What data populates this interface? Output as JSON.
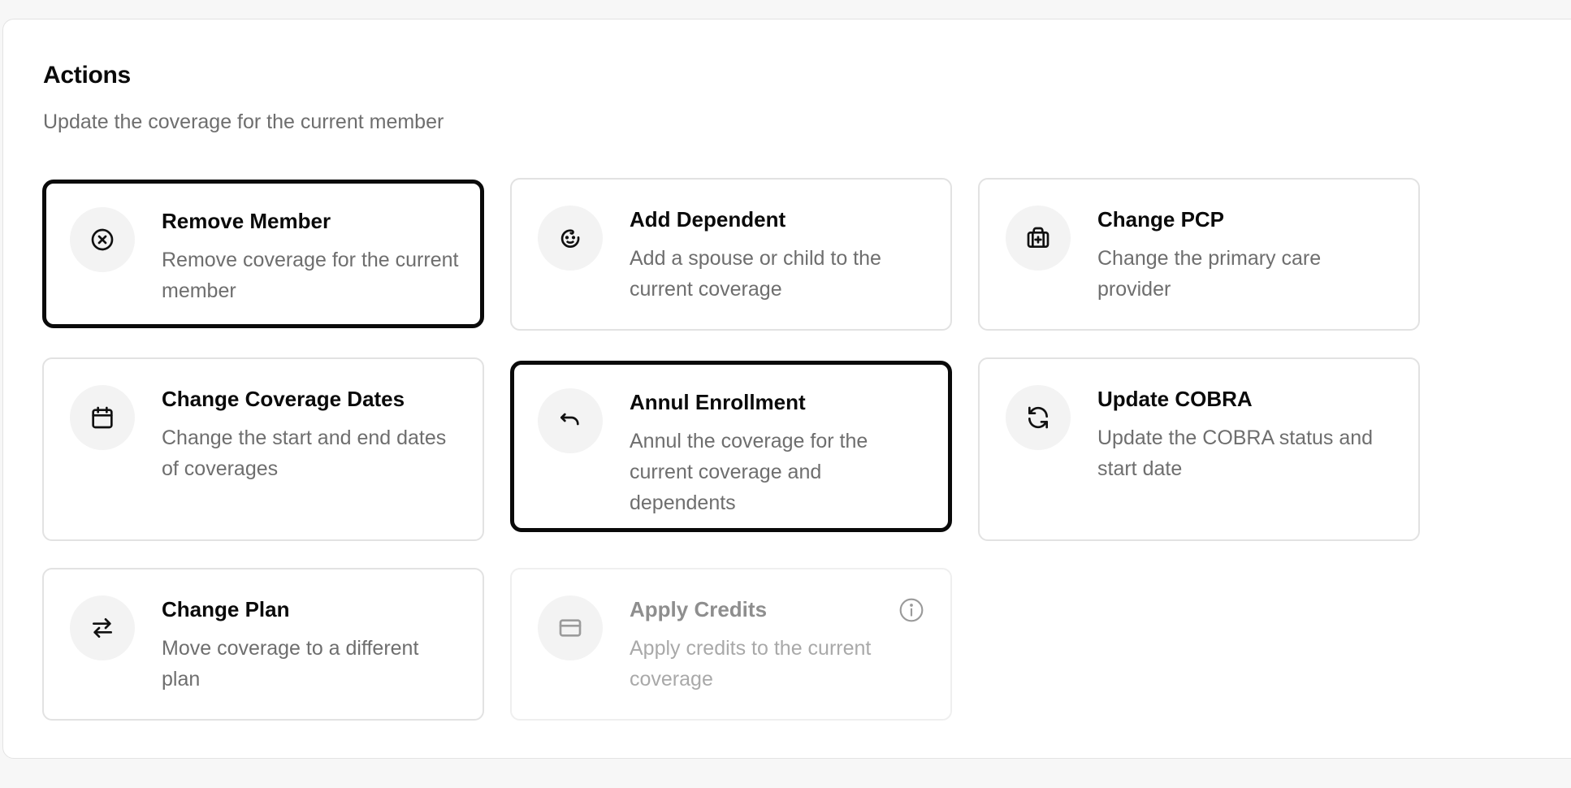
{
  "section": {
    "title": "Actions",
    "subtitle": "Update the coverage for the current member"
  },
  "actions": [
    {
      "title": "Remove Member",
      "description": "Remove coverage for the current member",
      "icon": "x-circle-icon",
      "state": "selected"
    },
    {
      "title": "Add Dependent",
      "description": "Add a spouse or child to the current coverage",
      "icon": "baby-face-icon",
      "state": "default"
    },
    {
      "title": "Change PCP",
      "description": "Change the primary care provider",
      "icon": "medical-bag-icon",
      "state": "default"
    },
    {
      "title": "Change Coverage Dates",
      "description": "Change the start and end dates of coverages",
      "icon": "calendar-icon",
      "state": "default"
    },
    {
      "title": "Annul Enrollment",
      "description": "Annul the coverage for the current coverage and dependents",
      "icon": "undo-icon",
      "state": "selected"
    },
    {
      "title": "Update COBRA",
      "description": "Update the COBRA status and start date",
      "icon": "refresh-icon",
      "state": "default"
    },
    {
      "title": "Change Plan",
      "description": "Move coverage to a different plan",
      "icon": "swap-arrows-icon",
      "state": "default"
    },
    {
      "title": "Apply Credits",
      "description": "Apply credits to the current coverage",
      "icon": "credit-card-icon",
      "state": "disabled",
      "info_icon": "info-icon"
    }
  ],
  "colors": {
    "page_background": "#f7f7f7",
    "panel_background": "#ffffff",
    "card_border": "#e2e2e2",
    "selected_border": "#0a0a0a",
    "icon_background": "#f3f3f3",
    "title_text": "#0a0a0a",
    "description_text": "#6e6e6e",
    "disabled_text": "#a9a9a9"
  }
}
